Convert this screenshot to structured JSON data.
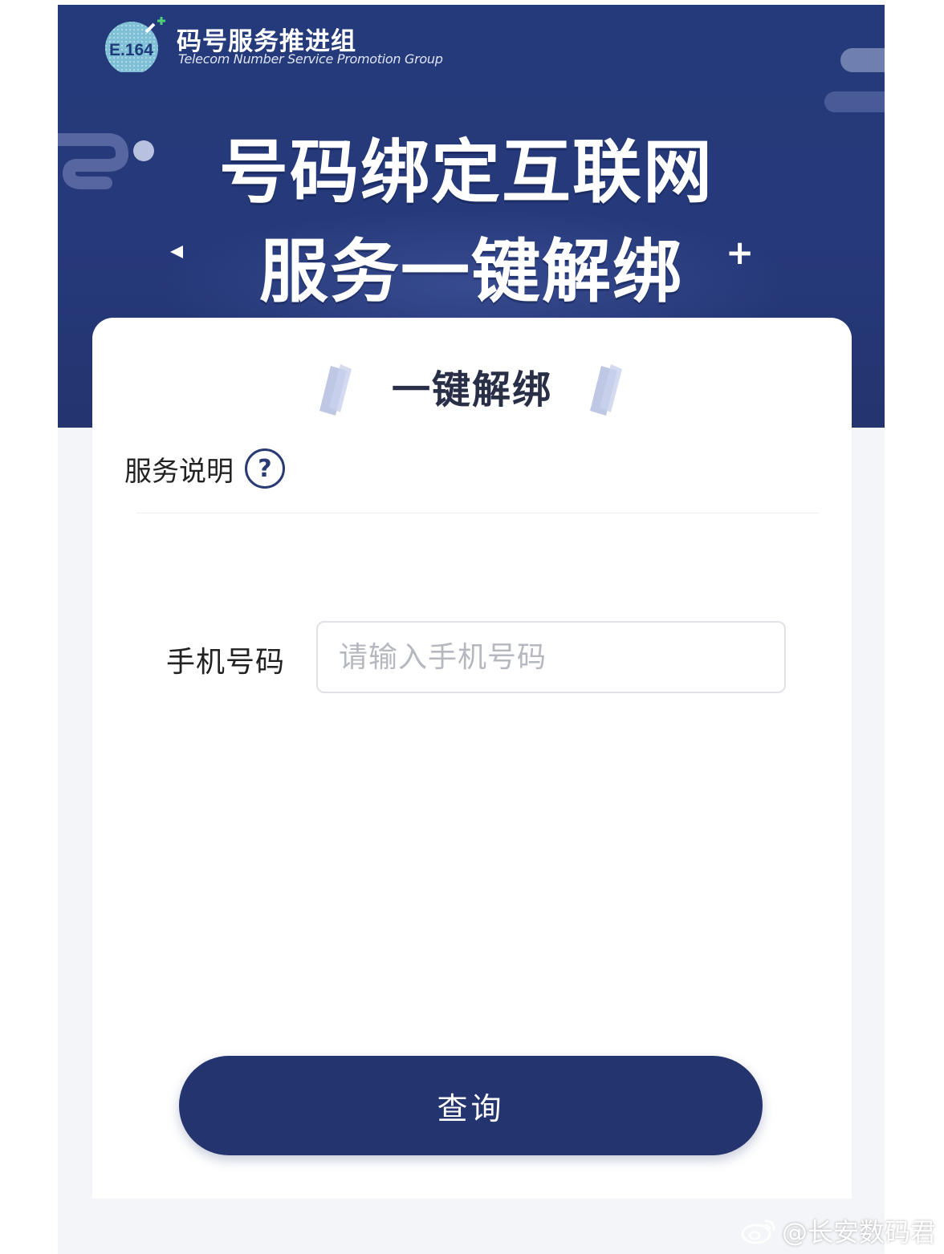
{
  "header": {
    "org_name_cn": "码号服务推进组",
    "org_name_en": "Telecom Number Service  Promotion Group",
    "logo_text": "E.164",
    "headline_line1": "号码绑定互联网",
    "headline_line2": "服务一键解绑",
    "headline_plus": "+"
  },
  "card": {
    "title": "一键解绑",
    "service_label": "服务说明",
    "help_symbol": "?",
    "phone_label": "手机号码",
    "phone_placeholder": "请输入手机号码",
    "phone_value": "",
    "query_button": "查询"
  },
  "watermark": {
    "text": "@长安数码君"
  },
  "colors": {
    "banner": "#253a7a",
    "button": "#24346f",
    "card": "#ffffff",
    "page_bg": "#f4f5f8"
  }
}
